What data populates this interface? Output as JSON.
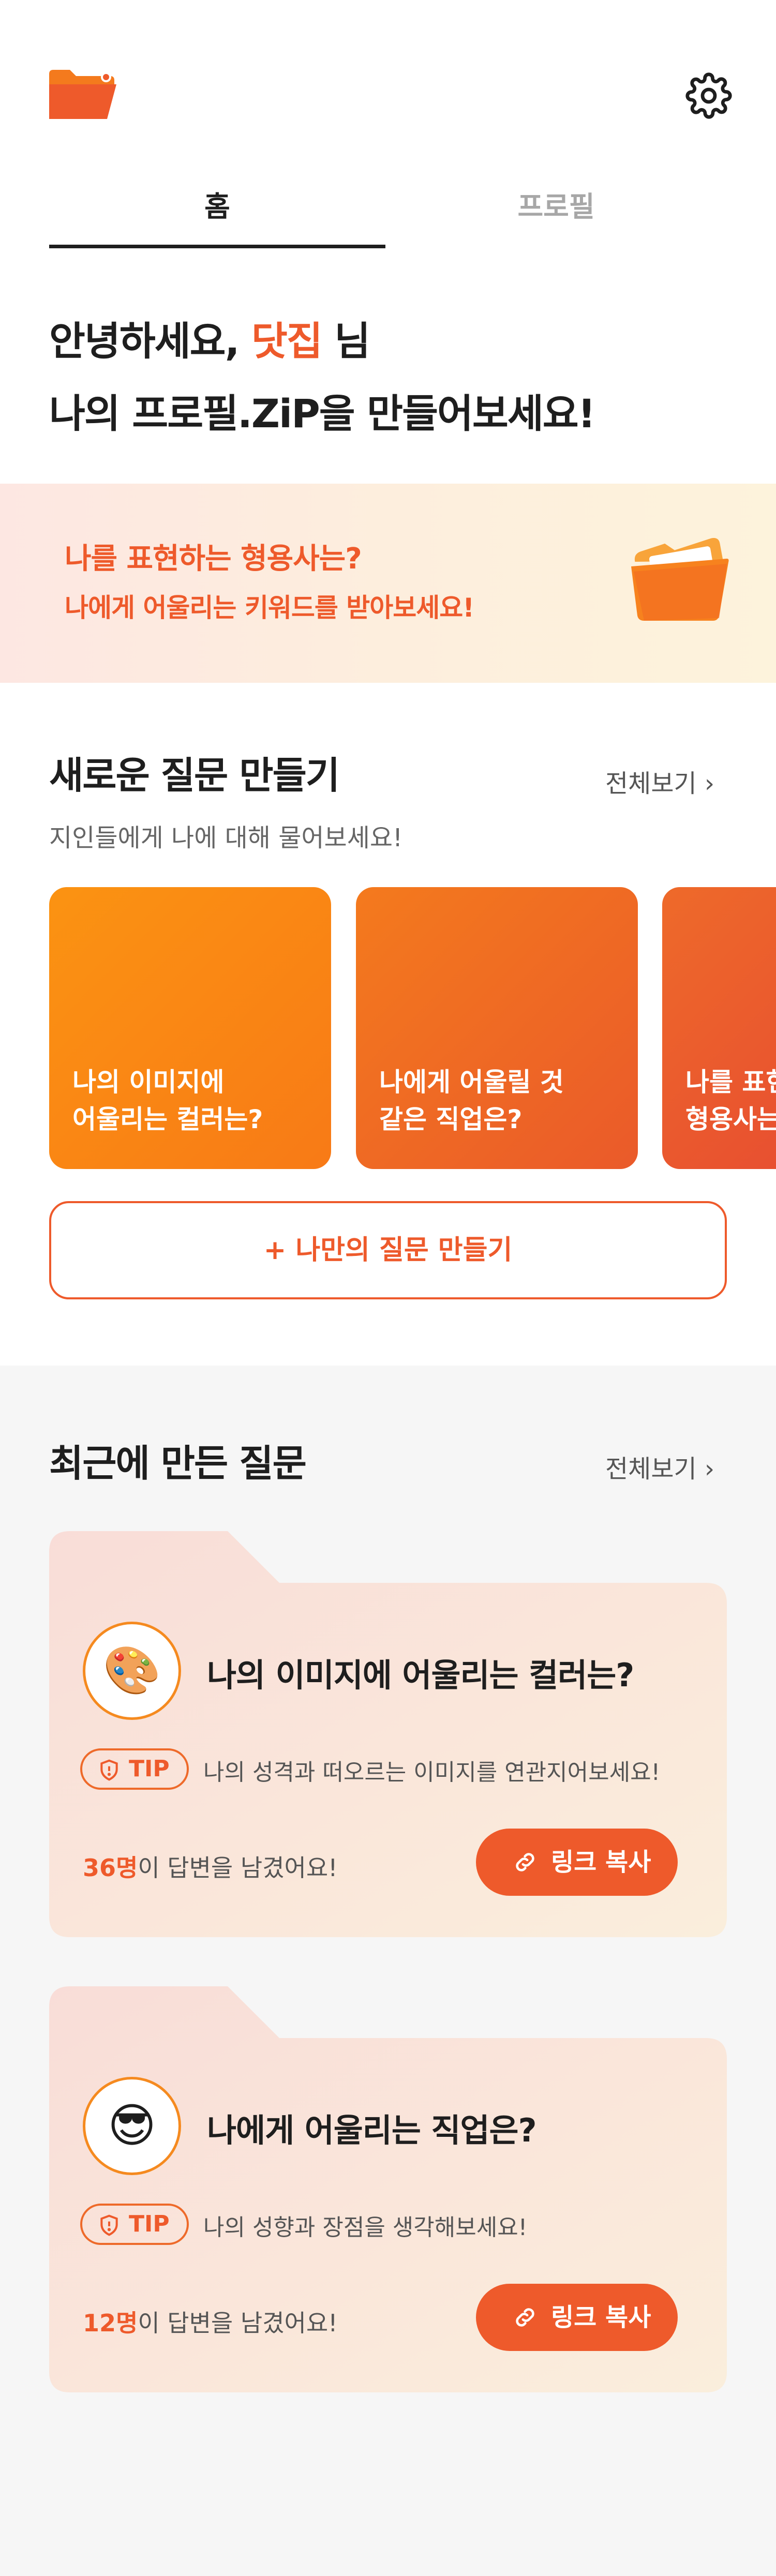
{
  "header": {
    "logo_icon": "folder-logo",
    "settings_icon": "gear-icon"
  },
  "tabs": [
    {
      "label": "홈",
      "active": true
    },
    {
      "label": "프로필",
      "active": false
    }
  ],
  "greeting": {
    "prefix": "안녕하세요, ",
    "name": "닷집",
    "suffix": " 님",
    "line2": "나의 프로필.ZiP을 만들어보세요!"
  },
  "banner": {
    "title": "나를 표현하는 형용사는?",
    "subtitle": "나에게 어울리는 키워드를 받아보세요!",
    "icon": "folder-icon"
  },
  "new_questions": {
    "title": "새로운 질문 만들기",
    "see_all": "전체보기",
    "subtitle": "지인들에게 나에 대해 물어보세요!",
    "cards": [
      {
        "text": "나의 이미지에\n어울리는 컬러는?"
      },
      {
        "text": "나에게 어울릴 것\n같은 직업은?"
      },
      {
        "text": "나를 표현하는\n형용사는?"
      }
    ],
    "make_button": "+ 나만의 질문 만들기"
  },
  "recent": {
    "title": "최근에 만든 질문",
    "see_all": "전체보기",
    "items": [
      {
        "emoji": "🎨",
        "emoji_name": "palette-emoji",
        "title": "나의 이미지에 어울리는 컬러는?",
        "tip_label": "TIP",
        "tip_text": "나의 성격과 떠오르는 이미지를 연관지어보세요!",
        "count": "36명",
        "count_suffix": "이 답변을 남겼어요!",
        "copy_label": "링크 복사"
      },
      {
        "emoji": "😎",
        "emoji_name": "sunglasses-emoji",
        "title": "나에게 어울리는 직업은?",
        "tip_label": "TIP",
        "tip_text": "나의 성향과 장점을 생각해보세요!",
        "count": "12명",
        "count_suffix": "이 답변을 남겼어요!",
        "copy_label": "링크 복사"
      }
    ]
  },
  "colors": {
    "accent": "#ee5a2b",
    "orange": "#fb9312",
    "text": "#1e1e1e",
    "muted": "#a7a7a7"
  }
}
